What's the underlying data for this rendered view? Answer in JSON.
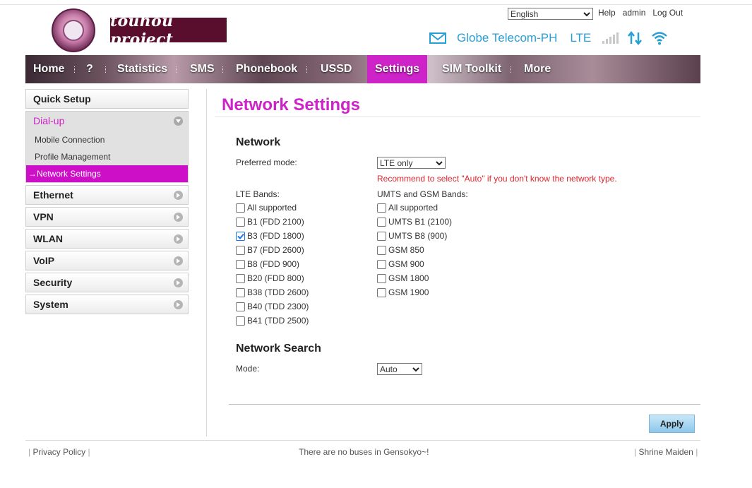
{
  "header": {
    "logo_badge_text": "TOUHOU PROJECT PATCHOULI",
    "logo_text": "touhou project",
    "language": "English",
    "links": [
      "Help",
      "admin",
      "Log Out"
    ],
    "carrier": "Globe Telecom-PH",
    "network_type": "LTE",
    "accent_color": "#2a9fd6"
  },
  "nav": {
    "items": [
      "Home",
      "?",
      "Statistics",
      "SMS",
      "Phonebook",
      "USSD",
      "Settings",
      "SIM Toolkit",
      "More"
    ],
    "active": "Settings",
    "active_color": "#cd23c8"
  },
  "sidebar": {
    "quick_setup": "Quick Setup",
    "dialup": "Dial-up",
    "dialup_subs": [
      "Mobile Connection",
      "Profile Management",
      "Network Settings"
    ],
    "active_sub_prefix": "→",
    "items": [
      "Ethernet",
      "VPN",
      "WLAN",
      "VoIP",
      "Security",
      "System"
    ]
  },
  "main": {
    "title": "Network Settings",
    "network_heading": "Network",
    "preferred_mode_label": "Preferred mode:",
    "preferred_mode_value": "LTE only",
    "recommendation": "Recommend to select \"Auto\" if you don't know the network type.",
    "lte_bands_label": "LTE Bands:",
    "umts_gsm_bands_label": "UMTS and GSM Bands:",
    "lte_bands": [
      {
        "label": "All supported",
        "checked": false
      },
      {
        "label": "B1 (FDD 2100)",
        "checked": false
      },
      {
        "label": "B3 (FDD 1800)",
        "checked": true
      },
      {
        "label": "B7 (FDD 2600)",
        "checked": false
      },
      {
        "label": "B8 (FDD 900)",
        "checked": false
      },
      {
        "label": "B20 (FDD 800)",
        "checked": false
      },
      {
        "label": "B38 (TDD 2600)",
        "checked": false
      },
      {
        "label": "B40 (TDD 2300)",
        "checked": false
      },
      {
        "label": "B41 (TDD 2500)",
        "checked": false
      }
    ],
    "umts_gsm_bands": [
      {
        "label": "All supported",
        "checked": false
      },
      {
        "label": "UMTS B1 (2100)",
        "checked": false
      },
      {
        "label": "UMTS B8 (900)",
        "checked": false
      },
      {
        "label": "GSM 850",
        "checked": false
      },
      {
        "label": "GSM 900",
        "checked": false
      },
      {
        "label": "GSM 1800",
        "checked": false
      },
      {
        "label": "GSM 1900",
        "checked": false
      }
    ],
    "search_heading": "Network Search",
    "mode_label": "Mode:",
    "mode_value": "Auto",
    "apply_label": "Apply"
  },
  "footer": {
    "privacy": "Privacy Policy",
    "tagline": "There are no buses in Gensokyo~!",
    "right": "Shrine Maiden"
  }
}
